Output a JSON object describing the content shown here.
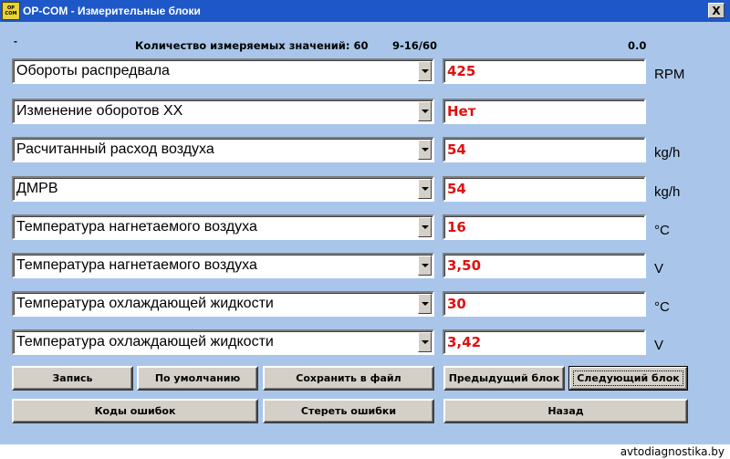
{
  "window": {
    "icon_text": "OP COM",
    "title": "OP-COM - Измерительные блоки",
    "close_label": "X"
  },
  "header": {
    "dash": "-",
    "count_label": "Количество измеряемых значений: 60",
    "range": "9-16/60",
    "time": "0.0"
  },
  "rows": [
    {
      "label": "Обороты распредвала",
      "value": "425",
      "unit": "RPM"
    },
    {
      "label": "Изменение оборотов ХХ",
      "value": "Нет",
      "unit": ""
    },
    {
      "label": "Расчитанный расход воздуха",
      "value": "54",
      "unit": "kg/h"
    },
    {
      "label": "ДМРВ",
      "value": "54",
      "unit": "kg/h"
    },
    {
      "label": "Температура нагнетаемого воздуха",
      "value": "16",
      "unit": "°C"
    },
    {
      "label": "Температура нагнетаемого воздуха",
      "value": "3,50",
      "unit": "V"
    },
    {
      "label": "Температура охлаждающей жидкости",
      "value": "30",
      "unit": "°C"
    },
    {
      "label": "Температура охлаждающей жидкости",
      "value": "3,42",
      "unit": "V"
    }
  ],
  "buttons": {
    "record": "Запись",
    "default": "По умолчанию",
    "save_file": "Сохранить в файл",
    "prev_block": "Предыдущий блок",
    "next_block": "Следующий блок",
    "error_codes": "Коды ошибок",
    "clear_errors": "Стереть ошибки",
    "back": "Назад"
  },
  "colors": {
    "background": "#a9c6ea",
    "titlebar": "#1e57c8",
    "value_text": "#e01010"
  },
  "watermark": "avtodiagnostika.by"
}
